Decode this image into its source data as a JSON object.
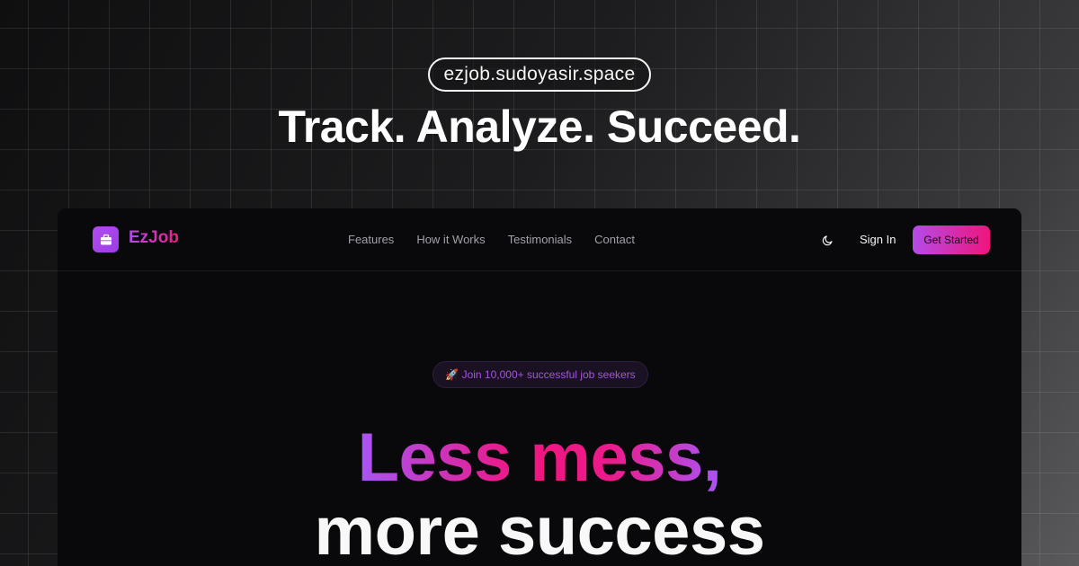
{
  "banner": {
    "domain": "ezjob.sudoyasir.space",
    "headline": "Track. Analyze. Succeed."
  },
  "navbar": {
    "logo_icon": "briefcase-icon",
    "brand": "EzJob",
    "links": [
      "Features",
      "How it Works",
      "Testimonials",
      "Contact"
    ],
    "theme_icon": "moon-icon",
    "sign_in": "Sign In",
    "cta": "Get Started"
  },
  "hero": {
    "badge_icon": "rocket-icon",
    "badge": "🚀 Join 10,000+ successful job seekers",
    "line1": "Less mess,",
    "line2": "more success"
  },
  "colors": {
    "accent_purple": "#a855f7",
    "accent_pink": "#f0147c",
    "window_bg": "#09090b"
  }
}
